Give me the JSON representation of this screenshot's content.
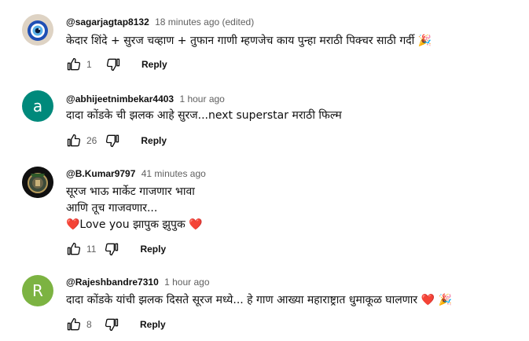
{
  "comments": [
    {
      "handle": "@sagarjagtap8132",
      "time": "18 minutes ago (edited)",
      "lines": [
        "केदार शिंदे + सुरज चव्हाण + तुफान गाणी म्हणजेच काय पुन्हा मराठी पिक्चर साठी गर्दी 🎉"
      ],
      "likes": "1",
      "reply_label": "Reply",
      "avatar_icon": "evil-eye-icon"
    },
    {
      "handle": "@abhijeetnimbekar4403",
      "time": "1 hour ago",
      "lines": [
        "दादा कोंडके ची झलक आहे सुरज...next superstar मराठी फिल्म"
      ],
      "likes": "26",
      "reply_label": "Reply",
      "avatar_letter": "a",
      "avatar_color": "#00897b"
    },
    {
      "handle": "@B.Kumar9797",
      "time": "41 minutes ago",
      "lines": [
        "सूरज भाऊ मार्केट गाजणार भावा",
        "आणि तूच गाजवणार...",
        "❤️Love you झापुक झुपुक  ❤️"
      ],
      "likes": "11",
      "reply_label": "Reply",
      "avatar_icon": "emblem-icon"
    },
    {
      "handle": "@Rajeshbandre7310",
      "time": "1 hour ago",
      "lines": [
        "दादा कोंडके यांची झलक दिसते सूरज मध्ये... हे गाण आख्या महाराष्ट्रात धुमाकूळ घालणार ❤️ 🎉"
      ],
      "likes": "8",
      "reply_label": "Reply",
      "avatar_letter": "R",
      "avatar_color": "#7cb342"
    }
  ],
  "icons": {
    "like": "thumbs-up-icon",
    "dislike": "thumbs-down-icon"
  }
}
